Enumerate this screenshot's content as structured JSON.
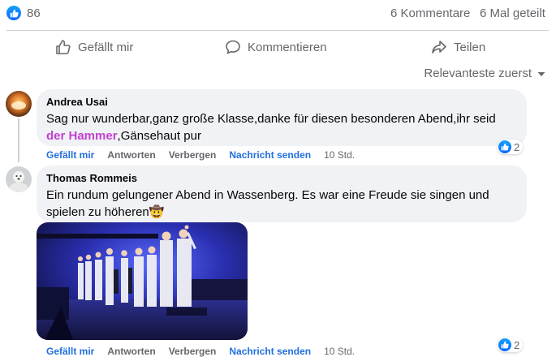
{
  "post_stats": {
    "reaction_count": "86",
    "comments": "6 Kommentare",
    "shares": "6 Mal geteilt"
  },
  "actions": {
    "like": "Gefällt mir",
    "comment": "Kommentieren",
    "share": "Teilen"
  },
  "sort_label": "Relevanteste zuerst",
  "comments": [
    {
      "author": "Andrea Usai",
      "text_before": "Sag nur wunderbar,ganz große Klasse,danke für diesen besonderen Abend,ihr seid ",
      "highlight": "der Hammer",
      "text_after": ",Gänsehaut pur",
      "like": "Gefällt mir",
      "reply": "Antworten",
      "hide": "Verbergen",
      "message": "Nachricht senden",
      "time": "10 Std.",
      "reactions": "2"
    },
    {
      "author": "Thomas Rommeis",
      "text": "Ein rundum gelungener Abend in Wassenberg. Es war eine Freude sie singen und spielen zu höheren",
      "emoji": "🤠",
      "like": "Gefällt mir",
      "reply": "Antworten",
      "hide": "Verbergen",
      "message": "Nachricht senden",
      "time": "10 Std.",
      "reactions": "2"
    }
  ],
  "colors": {
    "accent": "#0866ff",
    "highlight": "#c43fd0",
    "bubble": "#f0f2f5",
    "muted": "#65676b"
  }
}
